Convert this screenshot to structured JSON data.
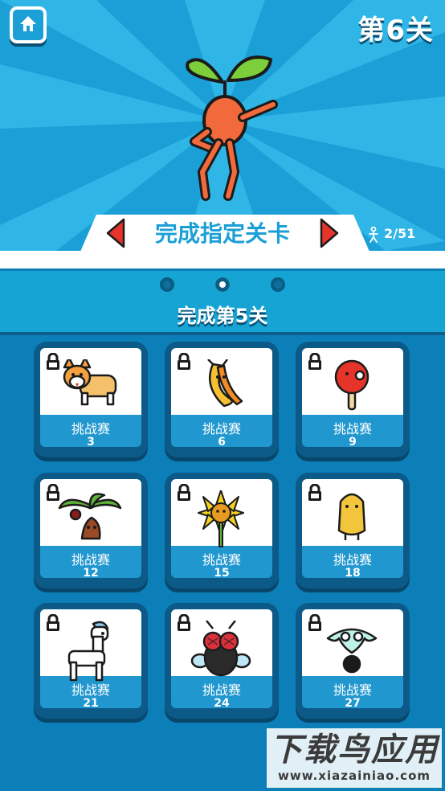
{
  "header": {
    "level_label": "第6关",
    "home_icon": "home-icon"
  },
  "banner": {
    "task_text": "完成指定关卡",
    "progress": "2/51",
    "left_arrow_icon": "arrow-left-icon",
    "right_arrow_icon": "arrow-right-icon"
  },
  "pager": {
    "pages": 3,
    "active_index": 1
  },
  "stage": {
    "title": "完成第5关"
  },
  "cards": [
    {
      "name": "挑战赛",
      "level": "3",
      "character": "corgi-dog"
    },
    {
      "name": "挑战赛",
      "level": "6",
      "character": "banana"
    },
    {
      "name": "挑战赛",
      "level": "9",
      "character": "ping-pong-paddle"
    },
    {
      "name": "挑战赛",
      "level": "12",
      "character": "coconut-tree"
    },
    {
      "name": "挑战赛",
      "level": "15",
      "character": "sunflower"
    },
    {
      "name": "挑战赛",
      "level": "18",
      "character": "potato"
    },
    {
      "name": "挑战赛",
      "level": "21",
      "character": "alpaca"
    },
    {
      "name": "挑战赛",
      "level": "24",
      "character": "fly"
    },
    {
      "name": "挑战赛",
      "level": "27",
      "character": "ghost-bomb"
    }
  ],
  "watermark": {
    "title": "下载鸟应用",
    "url": "www.xiazainiao.com"
  },
  "colors": {
    "sky_blue": "#1aa3d9",
    "dark_blue": "#0b5a88",
    "accent_red": "#e7342a",
    "character_orange": "#f26a3b"
  }
}
